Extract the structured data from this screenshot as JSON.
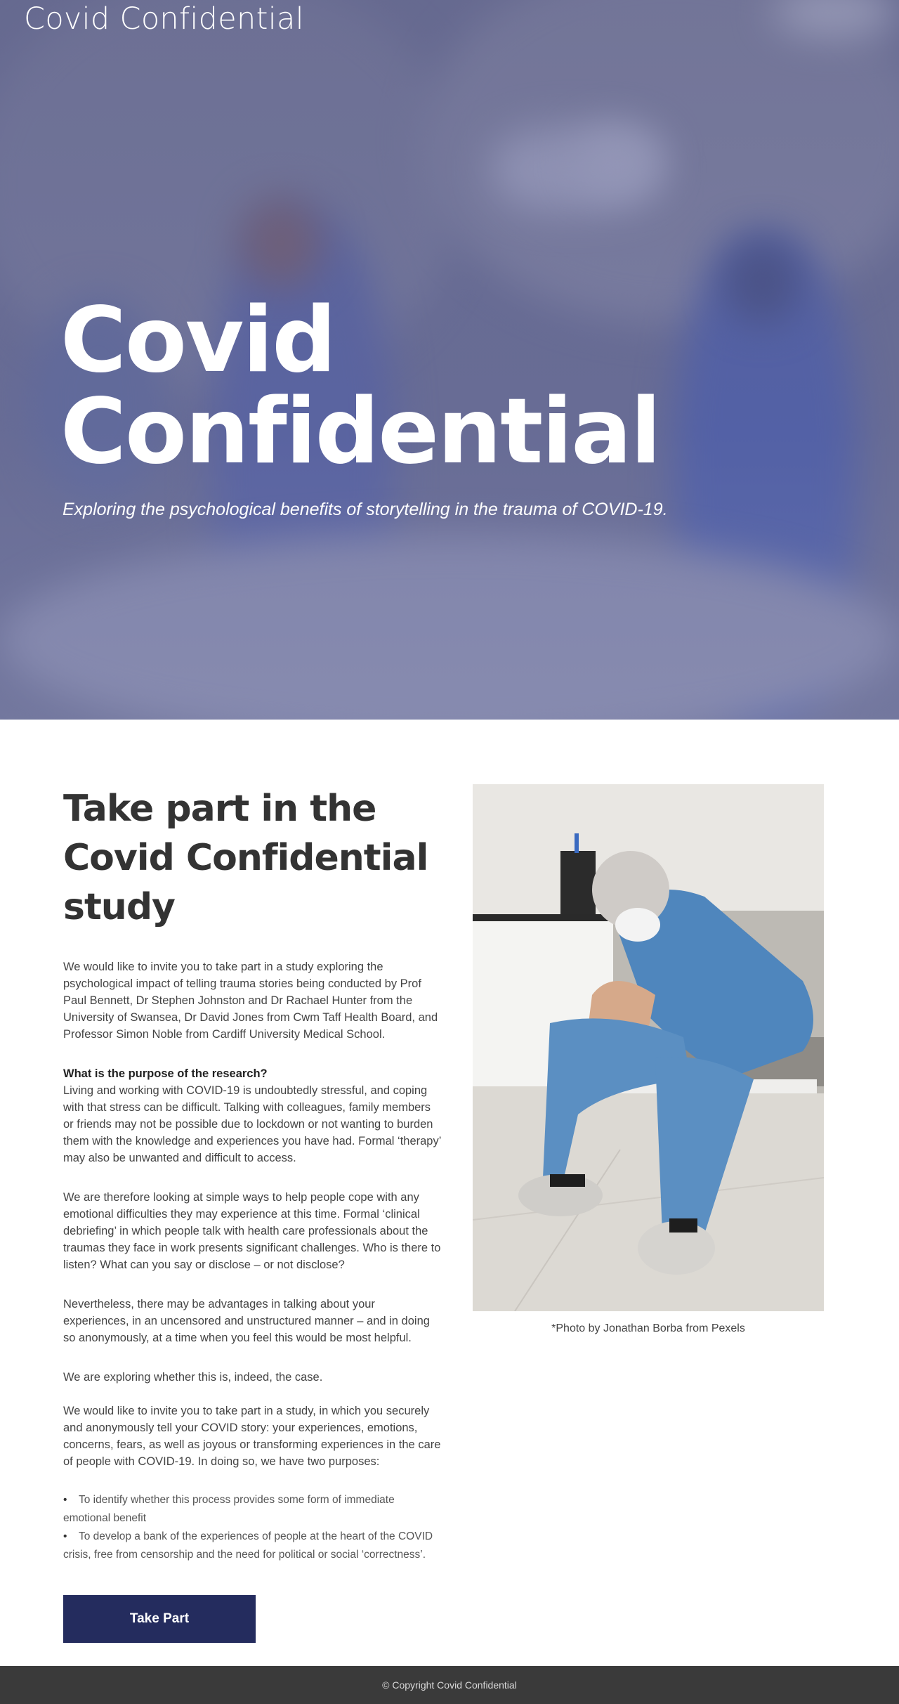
{
  "header": {
    "site_title": "Covid Confidential"
  },
  "hero": {
    "heading_line1": "Covid",
    "heading_line2": "Confidential",
    "subtitle": "Exploring the psychological benefits of storytelling in the trauma of COVID-19."
  },
  "study": {
    "heading": "Take part in the Covid Confidential study",
    "intro": "We would like to invite you to take part in a study exploring the psychological impact of telling trauma stories being conducted by Prof Paul Bennett, Dr Stephen Johnston and Dr Rachael Hunter from the University of Swansea, Dr David Jones from Cwm Taff Health Board, and Professor Simon Noble from Cardiff University Medical School.",
    "purpose_question": "What is the purpose of the research?",
    "purpose_text": "Living and working with COVID-19 is undoubtedly stressful, and coping with that stress can be difficult. Talking with colleagues, family members or friends may not be possible due to lockdown or not wanting to burden them with the knowledge and experiences you have had. Formal ‘therapy’ may also be unwanted and difficult to access.",
    "para_looking": "We are therefore looking at simple ways to help people cope with any emotional difficulties they may experience at this time. Formal ‘clinical debriefing’ in which people talk with health care professionals about the traumas they face in work presents significant challenges. Who is there to listen? What can you say or disclose – or not disclose?",
    "para_nevertheless": "Nevertheless, there may be advantages in talking about your experiences, in an uncensored and unstructured manner – and in doing so anonymously, at a time when you feel this would be most helpful.",
    "para_exploring": "We are exploring whether this is, indeed, the case.",
    "para_invite": "We would like to invite you to take part in a study, in which you securely and anonymously tell your COVID story: your experiences, emotions, concerns, fears, as well as joyous or transforming experiences in the care of people with COVID-19. In doing so, we have two purposes:",
    "purposes": [
      "To identify whether this process provides some form of immediate emotional benefit",
      "To develop a bank of the experiences of people at the heart of the COVID crisis, free from censorship and the need for political or social ‘correctness’."
    ],
    "button_label": "Take Part",
    "photo_caption": "*Photo by Jonathan Borba from Pexels"
  },
  "footer": {
    "copyright": "© Copyright Covid Confidential"
  },
  "colors": {
    "button_bg": "#242c5e",
    "footer_bg": "#3a3a3a",
    "hero_tint": "#6f7395"
  }
}
